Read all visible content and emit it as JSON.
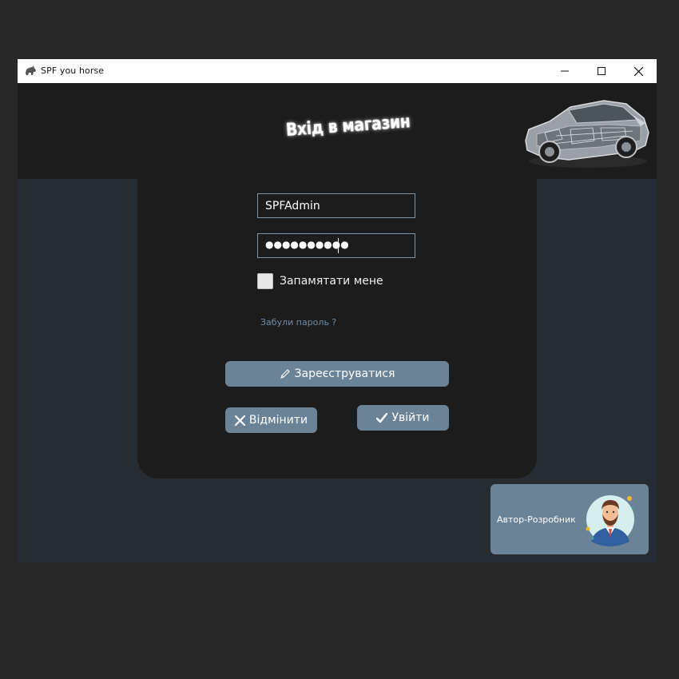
{
  "window": {
    "title": "SPF you horse",
    "controls": [
      "minimize-icon",
      "maximize-icon",
      "close-icon"
    ]
  },
  "header": {
    "title": "Вхід в магазин",
    "image": "car-cutaway-illustration"
  },
  "form": {
    "login_value": "SPFAdmin",
    "password_dots": "●●●●●●●●●●",
    "remember_label": "Запамятати мене",
    "remember_checked": false,
    "forgot_link": "Забули пароль ?",
    "register_label": "Зареєструватися",
    "register_icon": "pencil-icon",
    "cancel_label": "Відмінити",
    "cancel_icon": "x-icon",
    "login_label": "Увійти",
    "login_icon": "checkmark-icon"
  },
  "author": {
    "label": "Автор-Розробник",
    "avatar": "bearded-man-avatar"
  },
  "colors": {
    "background": "#282828",
    "window": "#262c31",
    "panel": "#1c1c1c",
    "accent": "#6b8396",
    "input_border": "#7d95a6",
    "link": "#6f8ea8"
  }
}
